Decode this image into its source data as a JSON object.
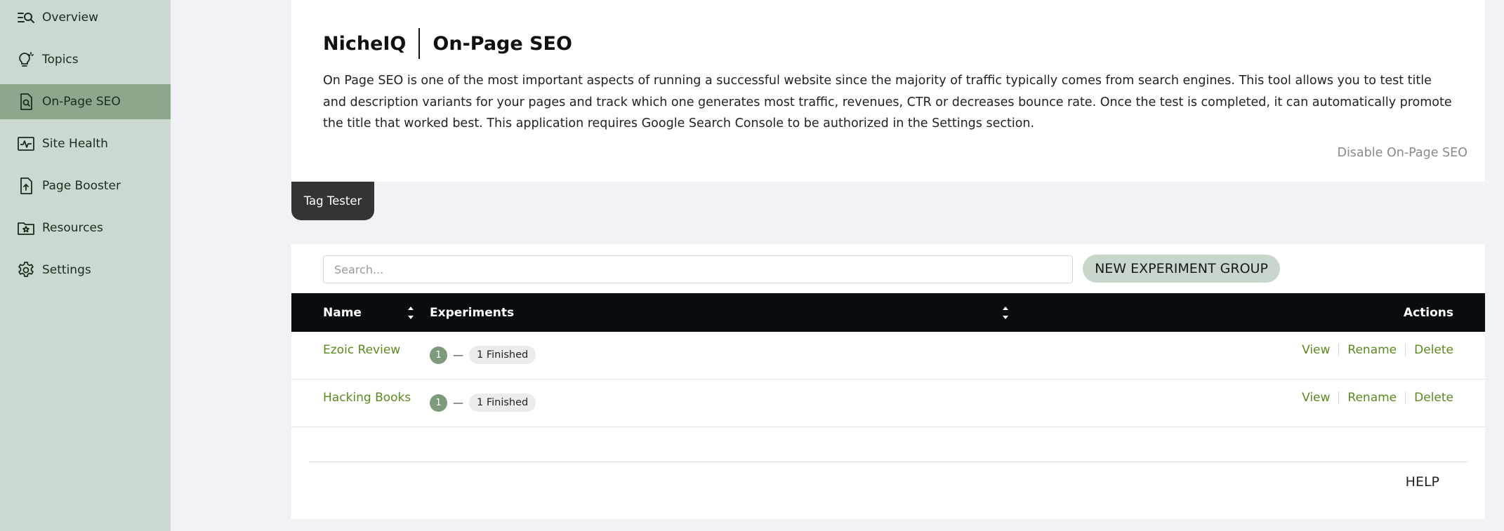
{
  "sidebar": {
    "items": [
      {
        "label": "Overview",
        "icon": "overview-search-icon",
        "active": false
      },
      {
        "label": "Topics",
        "icon": "lightbulb-icon",
        "active": false
      },
      {
        "label": "On-Page SEO",
        "icon": "document-search-icon",
        "active": true
      },
      {
        "label": "Site Health",
        "icon": "pulse-icon",
        "active": false
      },
      {
        "label": "Page Booster",
        "icon": "file-upload-icon",
        "active": false
      },
      {
        "label": "Resources",
        "icon": "folder-star-icon",
        "active": false
      },
      {
        "label": "Settings",
        "icon": "gear-icon",
        "active": false
      }
    ]
  },
  "header": {
    "brand": "NicheIQ",
    "title": "On-Page SEO",
    "description": "On Page SEO is one of the most important aspects of running a successful website since the majority of traffic typically comes from search engines. This tool allows you to test title and description variants for your pages and track which one generates most traffic, revenues, CTR or decreases bounce rate. Once the test is completed, it can automatically promote the title that worked best. This application requires Google Search Console to be authorized in the Settings section.",
    "disable_label": "Disable On-Page SEO"
  },
  "tabs": {
    "tag_tester": "Tag Tester"
  },
  "toolbar": {
    "search_placeholder": "Search...",
    "new_group_label": "NEW EXPERIMENT GROUP"
  },
  "table": {
    "columns": {
      "name": "Name",
      "experiments": "Experiments",
      "actions": "Actions"
    },
    "rows": [
      {
        "name": "Ezoic Review",
        "count": "1",
        "dash": "—",
        "status": "1 Finished"
      },
      {
        "name": "Hacking Books",
        "count": "1",
        "dash": "—",
        "status": "1 Finished"
      }
    ],
    "actions": {
      "view": "View",
      "rename": "Rename",
      "delete": "Delete"
    }
  },
  "footer": {
    "help_label": "HELP"
  },
  "colors": {
    "sidebar_bg": "#ccd9ce",
    "sidebar_active": "#8fa68e",
    "link_green": "#5a8a1e",
    "table_header_bg": "#0a0d10",
    "badge_bg": "#7e9a7c"
  }
}
